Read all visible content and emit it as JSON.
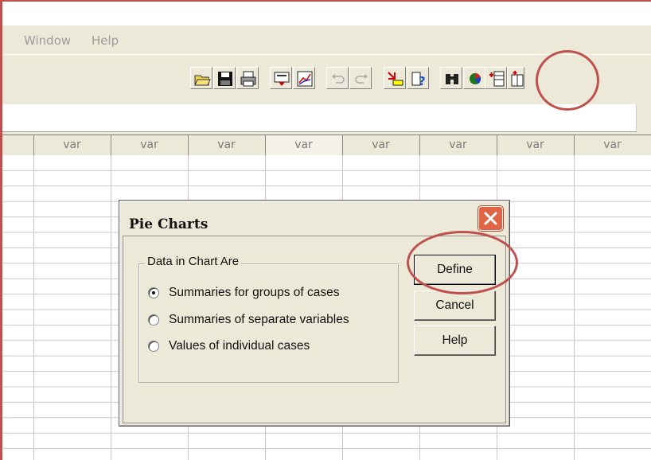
{
  "menubar": {
    "items": [
      "Window",
      "Help"
    ]
  },
  "toolbar": {
    "buttons": [
      "open-icon",
      "save-icon",
      "print-icon",
      "dialog-recall-icon",
      "chart-icon",
      "undo-icon",
      "redo-icon",
      "goto-case-icon",
      "variables-icon",
      "find-icon",
      "pie-chart-icon",
      "insert-case-icon",
      "insert-variable-icon"
    ]
  },
  "grid": {
    "column_headers": [
      "var",
      "var",
      "var",
      "var",
      "var",
      "var",
      "var",
      "var"
    ]
  },
  "dialog": {
    "title": "Pie Charts",
    "group_label": "Data in Chart Are",
    "options": [
      {
        "label": "Summaries for groups of cases",
        "selected": true
      },
      {
        "label": "Summaries of separate variables",
        "selected": false
      },
      {
        "label": "Values of individual cases",
        "selected": false
      }
    ],
    "buttons": {
      "define": "Define",
      "cancel": "Cancel",
      "help": "Help"
    }
  },
  "colors": {
    "annotation": "#c0504d",
    "dialog_bg": "#ece9d8",
    "close_button": "#e06446"
  }
}
